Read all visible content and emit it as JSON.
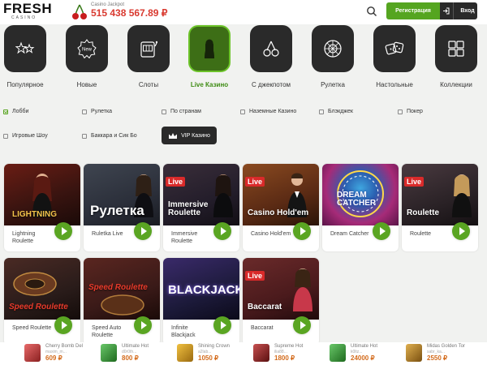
{
  "header": {
    "logo_main": "FRESH",
    "logo_sub": "CASINO",
    "jackpot_label": "Casino Jackpot",
    "jackpot_value": "515 438 567.89 ₽",
    "register_label": "Регистрация",
    "login_label": "Вход"
  },
  "categories": [
    {
      "label": "Популярное",
      "icon": "stars-icon"
    },
    {
      "label": "Новые",
      "icon": "new-badge-icon"
    },
    {
      "label": "Слоты",
      "icon": "slot-machine-icon"
    },
    {
      "label": "Live Казино",
      "icon": "live-dealer-icon",
      "active": true
    },
    {
      "label": "С джекпотом",
      "icon": "cherries-icon"
    },
    {
      "label": "Рулетка",
      "icon": "roulette-icon"
    },
    {
      "label": "Настольные",
      "icon": "dice-icon"
    },
    {
      "label": "Коллекции",
      "icon": "collection-icon"
    }
  ],
  "filters": [
    {
      "label": "Лобби",
      "checked": true
    },
    {
      "label": "Рулетка",
      "checked": false
    },
    {
      "label": "По странам",
      "checked": false
    },
    {
      "label": "Наземные Казино",
      "checked": false
    },
    {
      "label": "Блэкджек",
      "checked": false
    },
    {
      "label": "Покер",
      "checked": false
    },
    {
      "label": "Игровые Шоу",
      "checked": false
    },
    {
      "label": "Баккара и Сик Бо",
      "checked": false
    }
  ],
  "vip_label": "VIP Казино",
  "games": [
    {
      "name": "Lightning Roulette",
      "thumb_title": "LIGHTNING",
      "live": false,
      "bg": "#3a1410"
    },
    {
      "name": "Ruletka Live",
      "thumb_title": "Рулетка",
      "live": false,
      "bg": "#2b2f3a"
    },
    {
      "name": "Immersive Roulette",
      "thumb_title": "Immersive Roulette",
      "live": true,
      "bg": "#231d2a"
    },
    {
      "name": "Casino Hold'em",
      "thumb_title": "Casino Hold'em",
      "live": true,
      "bg": "#5a2a14"
    },
    {
      "name": "Dream Catcher",
      "thumb_title": "DREAM CATCHER",
      "live": false,
      "bg": "#a62b78"
    },
    {
      "name": "Roulette",
      "thumb_title": "Roulette",
      "live": true,
      "bg": "#2a2226"
    },
    {
      "name": "Speed Roulette",
      "thumb_title": "Speed Roulette",
      "live": false,
      "bg": "#2a1c1a"
    },
    {
      "name": "Speed Auto Roulette",
      "thumb_title": "Speed Roulette",
      "live": false,
      "bg": "#3a1a18"
    },
    {
      "name": "Infinite Blackjack",
      "thumb_title": "BLACKJACK",
      "live": false,
      "bg": "#1c1a3a"
    },
    {
      "name": "Baccarat",
      "thumb_title": "Baccarat",
      "live": true,
      "bg": "#4a1a1c"
    }
  ],
  "winners": [
    {
      "game": "Cherry Bomb Del",
      "user": "maxim_m...",
      "amount": "609 ₽",
      "color": "#c94b4b"
    },
    {
      "game": "Ultimate Hot",
      "user": "d0r0th...",
      "amount": "800 ₽",
      "color": "#3a8a3a"
    },
    {
      "game": "Shining Crown",
      "user": "a2lab...",
      "amount": "1050 ₽",
      "color": "#c78a1c"
    },
    {
      "game": "Supreme Hot",
      "user": "ilia88...",
      "amount": "1800 ₽",
      "color": "#8a2a2a"
    },
    {
      "game": "Ultimate Hot",
      "user": "k0ltz...",
      "amount": "24000 ₽",
      "color": "#3a8a3a"
    },
    {
      "game": "Midas Golden Tor",
      "user": "sabr_ka...",
      "amount": "2550 ₽",
      "color": "#b0862a"
    }
  ],
  "colors": {
    "accent": "#55a520",
    "dark": "#2a2a2a",
    "jackpot": "#d93a30"
  }
}
